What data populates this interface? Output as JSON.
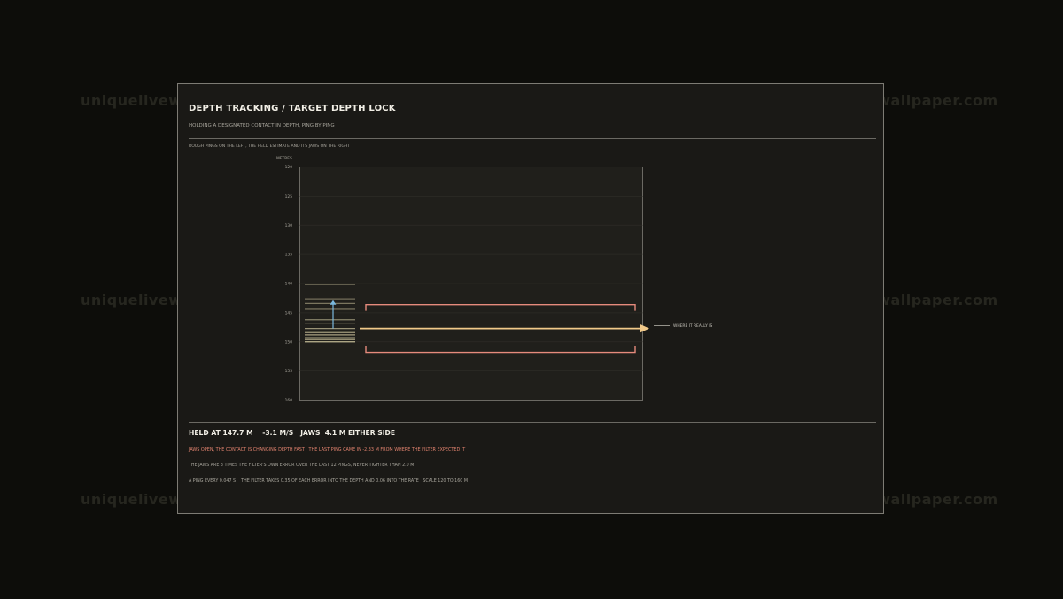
{
  "watermark": "uniquelivewallpaper.com",
  "header": {
    "title": "DEPTH TRACKING / TARGET DEPTH LOCK",
    "subtitle": "HOLDING A DESIGNATED CONTACT IN DEPTH, PING BY PING"
  },
  "chart_caption": "ROUGH PINGS ON THE LEFT, THE HELD ESTIMATE AND ITS JAWS ON THE RIGHT",
  "chart_data": {
    "type": "line",
    "ylabel": "METRES",
    "ylim": [
      120,
      160
    ],
    "y_inverted": true,
    "yticks": [
      "120",
      "125",
      "130",
      "135",
      "140",
      "145",
      "150",
      "155",
      "160"
    ],
    "pings": [
      140.2,
      142.6,
      143.4,
      144.4,
      146.2,
      146.8,
      147.7,
      148.4,
      148.8,
      149.3,
      149.6,
      150.0
    ],
    "held_depth": 147.7,
    "jaw_upper": 143.6,
    "jaw_lower": 151.8,
    "rate_arrow": {
      "from": 147.7,
      "to": 143.0
    },
    "true_depth_label": "WHERE IT REALLY IS",
    "true_depth": 147.2,
    "colors": {
      "ping": "#c9c09a",
      "held": "#f1c98a",
      "jaws": "#e58a7c",
      "rate": "#7ab8de",
      "axis": "#6b6963"
    }
  },
  "status": {
    "held_line": "HELD AT 147.7 M    -3.1 M/S   JAWS  4.1 M EITHER SIDE",
    "warning": "JAWS OPEN, THE CONTACT IS CHANGING DEPTH FAST   THE LAST PING CAME IN -2.33 M FROM WHERE THE FILTER EXPECTED IT",
    "note_jaws": "THE JAWS ARE 3 TIMES THE FILTER'S OWN ERROR OVER THE LAST 12 PINGS, NEVER TIGHTER THAN 2.0 M",
    "note_filter": "A PING EVERY 0.047 S    THE FILTER TAKES 0.35 OF EACH ERROR INTO THE DEPTH AND 0.06 INTO THE RATE   SCALE 120 TO 160 M"
  }
}
